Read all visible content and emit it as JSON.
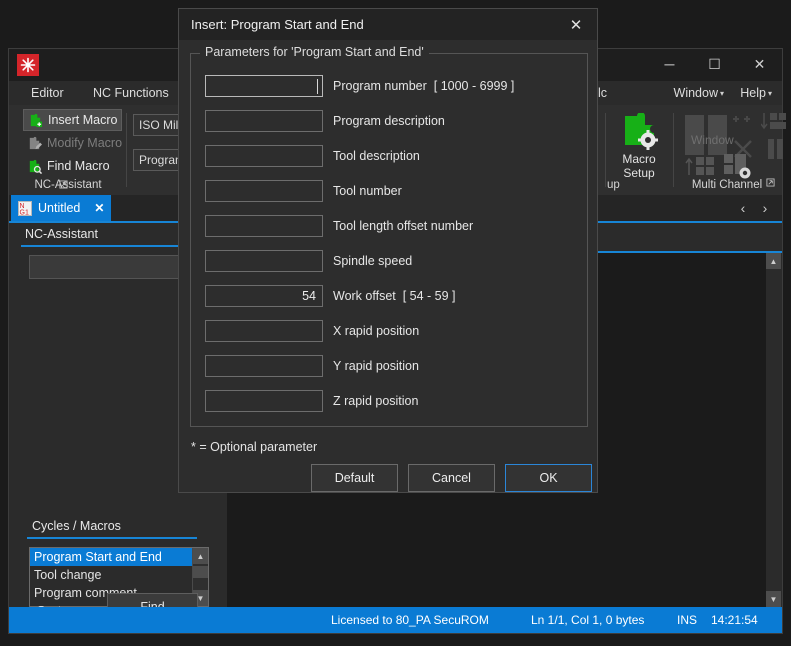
{
  "app": {
    "logo_icon": "snowflake-logo",
    "window_controls": {
      "minimize": "─",
      "maximize": "☐",
      "close": "✕"
    },
    "menus": [
      {
        "label": "Editor",
        "caret": ""
      },
      {
        "label": "NC Functions",
        "caret": ""
      },
      {
        "label": "alc",
        "caret": ""
      },
      {
        "label": "Window",
        "caret": "▾"
      },
      {
        "label": "Help",
        "caret": "▾"
      }
    ]
  },
  "ribbon": {
    "ncassistant": {
      "caption": "NC-Assistant",
      "dialog_launcher": "⤵",
      "buttons": [
        {
          "label": "Insert Macro",
          "icon": "puzzle-plus-icon",
          "state": "selected"
        },
        {
          "label": "Modify Macro",
          "icon": "puzzle-pencil-icon",
          "state": "disabled"
        },
        {
          "label": "Find Macro",
          "icon": "puzzle-search-icon",
          "state": "normal"
        }
      ]
    },
    "selectors": {
      "iso_combo": "ISO Milli",
      "program_combo": "Program"
    },
    "macro_setup": {
      "label_line1": "Macro",
      "label_line2": "Setup",
      "caption": "up",
      "icon": "puzzle-gear-icon"
    },
    "multichannel": {
      "caption": "Multi Channel",
      "window_label": "Window",
      "dialog_launcher": "⤵",
      "icons": [
        "split-vertical-icon",
        "add-columns-icon",
        "arrange-down-icon",
        "close-all-icon",
        "split-pair-icon",
        "arrange-up-icon",
        "channel-settings-icon"
      ]
    }
  },
  "tabstrip": {
    "document_tab": {
      "label": "Untitled",
      "icon": "nc-document-icon",
      "close": "✕"
    },
    "nav_prev": "‹",
    "nav_next": "›"
  },
  "left_panel": {
    "assistant_tab": "NC-Assistant",
    "assistant_input_value": "",
    "cycles_tab": "Cycles / Macros",
    "macro_list": [
      {
        "label": "Program Start and End",
        "selected": true
      },
      {
        "label": "Tool change",
        "selected": false
      },
      {
        "label": "Program comment",
        "selected": false
      }
    ],
    "scroll_up": "▲",
    "scroll_down": "▼",
    "system_label": "System",
    "find_button": "Find"
  },
  "statusbar": {
    "license": "Licensed to 80_PA SecuROM",
    "position": "Ln 1/1, Col 1, 0 bytes",
    "insert_mode": "INS",
    "time": "14:21:54"
  },
  "dialog": {
    "title": "Insert: Program Start and End",
    "close_icon": "✕",
    "legend": "Parameters for 'Program Start and End'",
    "parameters": [
      {
        "label": "Program number",
        "range": "[ 1000 - 6999 ]",
        "value": "",
        "focused": true
      },
      {
        "label": "Program description",
        "range": "",
        "value": "",
        "focused": false
      },
      {
        "label": "Tool description",
        "range": "",
        "value": "",
        "focused": false
      },
      {
        "label": "Tool number",
        "range": "",
        "value": "",
        "focused": false
      },
      {
        "label": "Tool length offset number",
        "range": "",
        "value": "",
        "focused": false
      },
      {
        "label": "Spindle speed",
        "range": "",
        "value": "",
        "focused": false
      },
      {
        "label": "Work offset",
        "range": "[ 54 - 59 ]",
        "value": "54",
        "focused": false
      },
      {
        "label": "X rapid position",
        "range": "",
        "value": "",
        "focused": false
      },
      {
        "label": "Y rapid position",
        "range": "",
        "value": "",
        "focused": false
      },
      {
        "label": "Z rapid position",
        "range": "",
        "value": "",
        "focused": false
      }
    ],
    "optional_note": "*  =  Optional parameter",
    "buttons": {
      "default": "Default",
      "cancel": "Cancel",
      "ok": "OK"
    }
  },
  "colors": {
    "accent_blue": "#0a7bd4",
    "underline_blue": "#1785d6",
    "focus_blue": "#2b86d8",
    "logo_red": "#d4252a",
    "macro_green": "#17b017",
    "window_bg": "#2b2b2b",
    "dialog_bg": "#2d2d2d",
    "editor_bg": "#1b1b1b"
  }
}
